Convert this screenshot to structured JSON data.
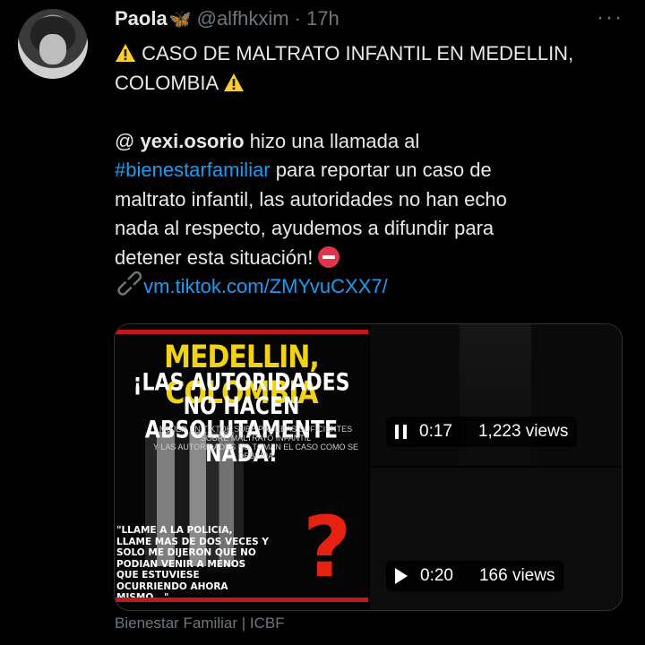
{
  "user": {
    "name": "Paola",
    "butterfly_icon": "blue-butterfly-icon",
    "handle": "@alfhkxim",
    "separator": "·",
    "time": "17h",
    "more_icon": "more-options-icon"
  },
  "tweet": {
    "line1": "CASO DE MALTRATO INFANTIL EN MEDELLIN,",
    "line2": "COLOMBIA",
    "mention_prefix": "@ ",
    "mention": "yexi.osorio",
    "text1": " hizo una llamada al",
    "hashtag": "#bienestarfamiliar",
    "text2": " para reportar un caso de",
    "text3": "maltrato infantil, las autoridades no han echo",
    "text4": "nada al respecto, ayudemos a difundir para",
    "text5": "detener esta situación!",
    "link": "vm.tiktok.com/ZMYvuCXX7/"
  },
  "media": {
    "poster": {
      "title": "MEDELLIN, COLOMBIA",
      "sub1": "¡LAS AUTORIDADES NO HACEN",
      "sub2": "ABSOLUTAMENTE NADA!",
      "small1": "MUJER EN TIKTOK SUBE PRUEBAS SUFICIENTES SOBRE MALTRATO INFANTIL",
      "small2": "Y LAS AUTORIDADES NO TOMAN EL CASO COMO SE DEBERIA",
      "quote": "\"LLAME A LA POLICIA, LLAME MAS DE DOS VECES Y SOLO ME DIJERON QUE NO PODIAN VENIR A MENOS QUE ESTUVIESE OCURRIENDO AHORA MISMO...\"",
      "qmark": "?"
    },
    "video1": {
      "icon": "pause-icon",
      "time": "0:17",
      "views": "1,223 views"
    },
    "video2": {
      "icon": "play-icon",
      "time": "0:20",
      "views": "166 views"
    }
  },
  "footer": {
    "source": "Bienestar Familiar | ICBF"
  },
  "colors": {
    "link": "#1d9bf0",
    "muted": "#71767b",
    "text": "#e7e9ea",
    "background": "#000000"
  }
}
